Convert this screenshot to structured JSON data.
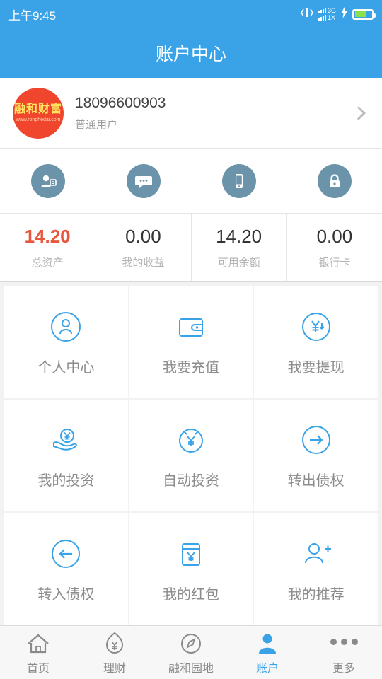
{
  "statusbar": {
    "time": "上午9:45",
    "vibrate_icon": "vibrate-icon",
    "signal_icon": "signal-bars-icon",
    "network_primary": "3G",
    "network_secondary": "1X",
    "charging_icon": "charging-bolt-icon",
    "battery_icon": "battery-icon",
    "battery_level": 72
  },
  "header": {
    "title": "账户中心"
  },
  "profile": {
    "avatar_name": "avatar",
    "avatar_text_main": "融和财富",
    "avatar_text_sub": "www.ronghedai.com",
    "phone": "18096600903",
    "role": "普通用户",
    "chevron_icon": "chevron-right-icon"
  },
  "quick_icons": [
    {
      "name": "user-card-icon",
      "label": ""
    },
    {
      "name": "message-icon",
      "label": ""
    },
    {
      "name": "mobile-phone-icon",
      "label": ""
    },
    {
      "name": "lock-icon",
      "label": ""
    }
  ],
  "stats": [
    {
      "value": "14.20",
      "label": "总资产",
      "color": "#e8563d"
    },
    {
      "value": "0.00",
      "label": "我的收益",
      "color": "#333333"
    },
    {
      "value": "14.20",
      "label": "可用余额",
      "color": "#333333"
    },
    {
      "value": "0.00",
      "label": "银行卡",
      "color": "#333333"
    }
  ],
  "grid": [
    {
      "icon": "person-circle-icon",
      "label": "个人中心"
    },
    {
      "icon": "wallet-icon",
      "label": "我要充值"
    },
    {
      "icon": "yuan-withdraw-icon",
      "label": "我要提现"
    },
    {
      "icon": "hand-yuan-icon",
      "label": "我的投资"
    },
    {
      "icon": "clock-yuan-icon",
      "label": "自动投资"
    },
    {
      "icon": "arrow-right-circle-icon",
      "label": "转出债权"
    },
    {
      "icon": "arrow-left-circle-icon",
      "label": "转入债权"
    },
    {
      "icon": "red-packet-icon",
      "label": "我的红包"
    },
    {
      "icon": "person-add-icon",
      "label": "我的推荐"
    }
  ],
  "tabbar": [
    {
      "icon": "home-icon",
      "label": "首页",
      "active": false
    },
    {
      "icon": "finance-yuan-icon",
      "label": "理财",
      "active": false
    },
    {
      "icon": "compass-icon",
      "label": "融和园地",
      "active": false
    },
    {
      "icon": "account-person-icon",
      "label": "账户",
      "active": true
    },
    {
      "icon": "more-dots-icon",
      "label": "更多",
      "active": false
    }
  ],
  "theme": {
    "accent": "#3aa3e8",
    "highlight": "#e8563d",
    "muted": "#b3b3b3",
    "tile_bg": "#ffffff",
    "page_bg": "#f2f2f2"
  }
}
